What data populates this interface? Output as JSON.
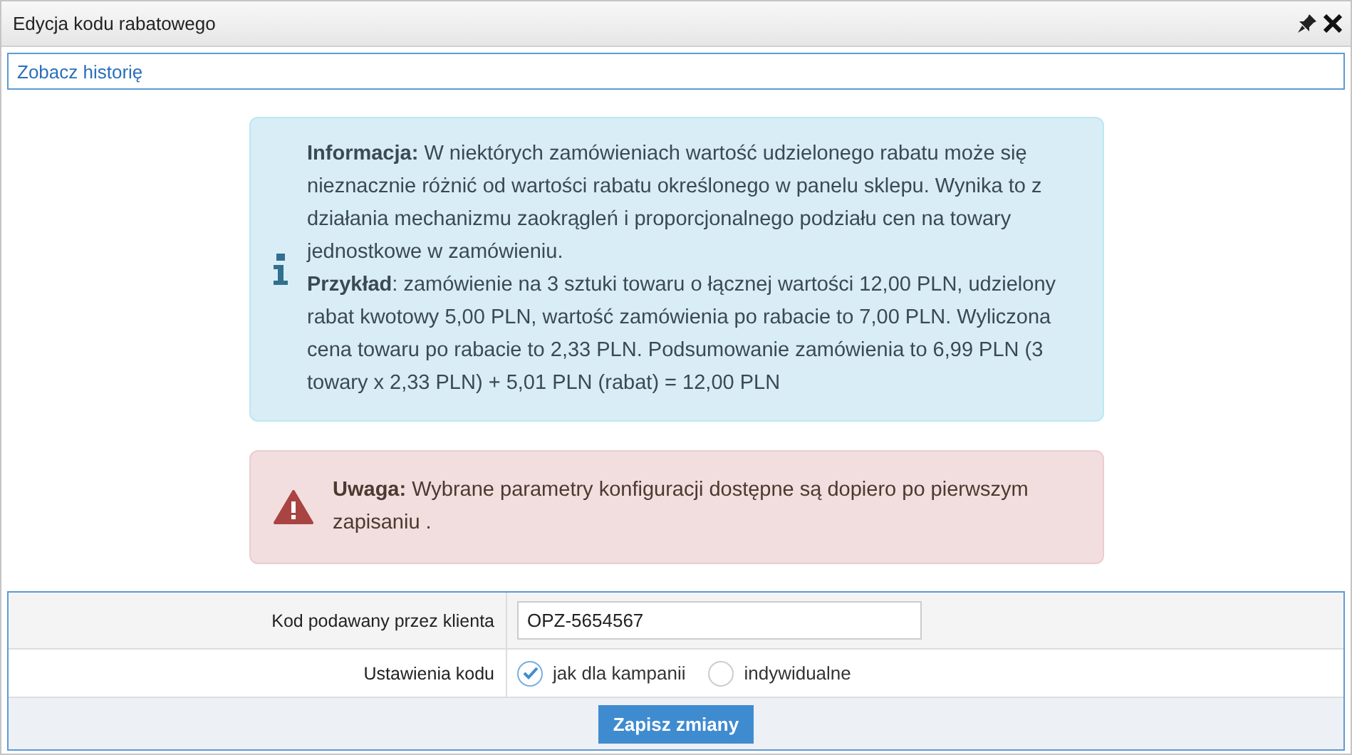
{
  "window": {
    "title": "Edycja kodu rabatowego"
  },
  "history_link": "Zobacz historię",
  "info": {
    "paragraphs": [
      "**Informacja:** W niektórych zamówieniach wartość udzielonego rabatu może się nieznacznie różnić od wartości rabatu określonego w panelu sklepu. Wynika to z działania mechanizmu zaokrągleń i proporcjonalnego podziału cen na towary jednostkowe w zamówieniu.",
      "**Przykład**: zamówienie na 3 sztuki towaru o łącznej wartości 12,00 PLN, udzielony rabat kwotowy 5,00 PLN, wartość zamówienia po rabacie to 7,00 PLN. Wyliczona cena towaru po rabacie to 2,33 PLN. Podsumowanie zamówienia to 6,99 PLN (3 towary x 2,33 PLN) + 5,01 PLN (rabat) = 12,00 PLN"
    ]
  },
  "warning": {
    "text": "**Uwaga:** Wybrane parametry konfiguracji dostępne są dopiero po pierwszym zapisaniu ."
  },
  "form": {
    "code_label": "Kod podawany przez klienta",
    "code_value": "OPZ-5654567",
    "settings_label": "Ustawienia kodu",
    "options": [
      {
        "label": "jak dla kampanii",
        "selected": true
      },
      {
        "label": "indywidualne",
        "selected": false
      }
    ],
    "save_button": "Zapisz zmiany"
  }
}
